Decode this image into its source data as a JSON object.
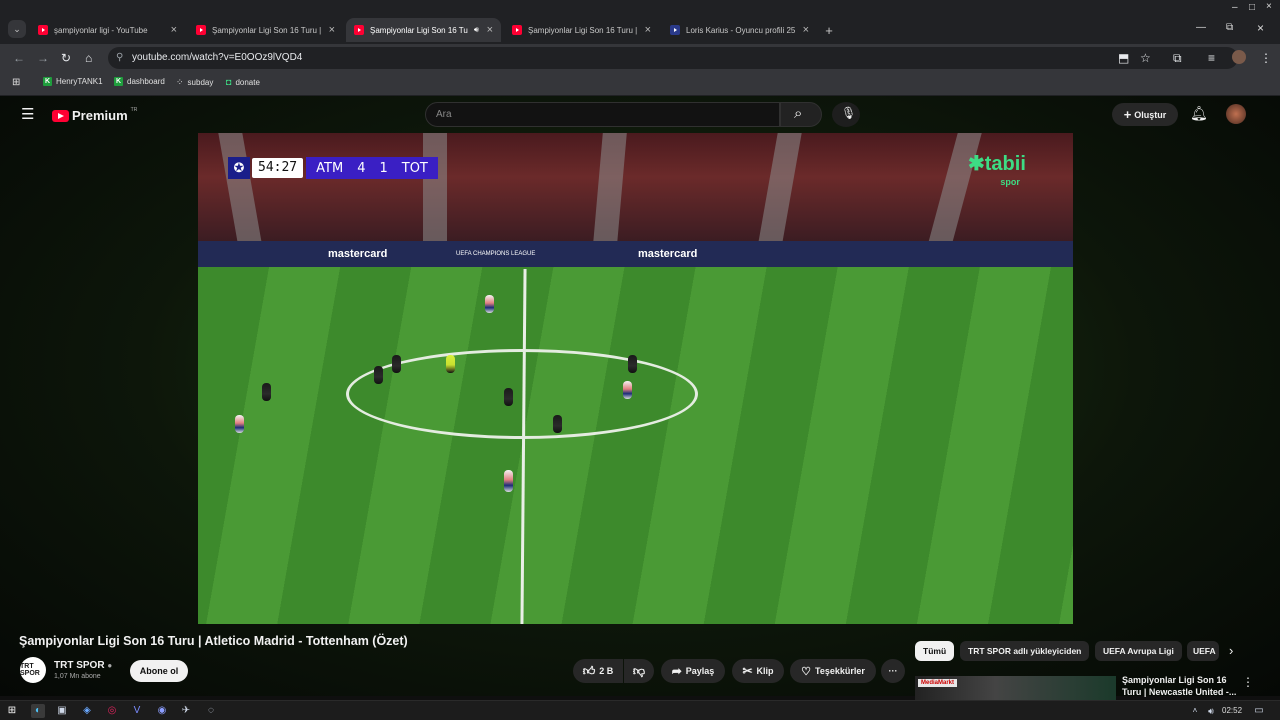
{
  "browser": {
    "tabs": [
      {
        "label": "şampiyonlar ligi - YouTube",
        "favicon": "youtube-icon",
        "active": false
      },
      {
        "label": "Şampiyonlar Ligi Son 16 Turu |",
        "favicon": "youtube-icon",
        "active": false
      },
      {
        "label": "Şampiyonlar Ligi Son 16 Tu",
        "favicon": "youtube-icon",
        "active": true
      },
      {
        "label": "Şampiyonlar Ligi Son 16 Turu |",
        "favicon": "youtube-icon",
        "active": false
      },
      {
        "label": "Loris Karius - Oyuncu profili 25",
        "favicon": "site-icon",
        "active": false
      }
    ],
    "new_tab": "+",
    "url": "youtube.com/watch?v=E0OOz9lVQD4",
    "bookmarks": [
      {
        "label": "HenryTANK1",
        "icon": "kick-icon"
      },
      {
        "label": "dashboard",
        "icon": "kick-icon"
      },
      {
        "label": "subday",
        "icon": "grid-icon"
      },
      {
        "label": "donate",
        "icon": "donate-icon"
      }
    ]
  },
  "youtube": {
    "logo_text": "Premium",
    "logo_sup": "TR",
    "search_placeholder": "Ara",
    "create_label": "Oluştur"
  },
  "video": {
    "scorebug": {
      "clock": "54:27",
      "home": "ATM",
      "home_score": "4",
      "away_score": "1",
      "away": "TOT"
    },
    "broadcaster": "tabii",
    "broadcaster_sub": "spor",
    "boards": [
      "mastercard",
      "UEFA CHAMPIONS LEAGUE",
      "mastercard"
    ]
  },
  "info": {
    "title": "Şampiyonlar Ligi Son 16 Turu | Atletico Madrid - Tottenham (Özet)",
    "channel_name": "TRT SPOR",
    "channel_avatar": "TRT SPOR",
    "subscribers": "1,07 Mn abone",
    "subscribe_label": "Abone ol",
    "like_count": "2 B",
    "share_label": "Paylaş",
    "clip_label": "Klip",
    "thanks_label": "Teşekkürler",
    "more_label": "···"
  },
  "sidebar": {
    "chips": [
      {
        "label": "Tümü",
        "active": true
      },
      {
        "label": "TRT SPOR adlı yükleyiciden",
        "active": false
      },
      {
        "label": "UEFA Avrupa Ligi",
        "active": false
      },
      {
        "label": "UEFA",
        "active": false
      }
    ],
    "recommend_title": "Şampiyonlar Ligi Son 16 Turu | Newcastle United -...",
    "thumb_logo": "MediaMarkt"
  },
  "taskbar": {
    "time": "02:52"
  },
  "colors": {
    "youtube_red": "#ff0033",
    "scorebug_purple": "#3a1fc4",
    "tabii_green": "#3ddc84"
  }
}
